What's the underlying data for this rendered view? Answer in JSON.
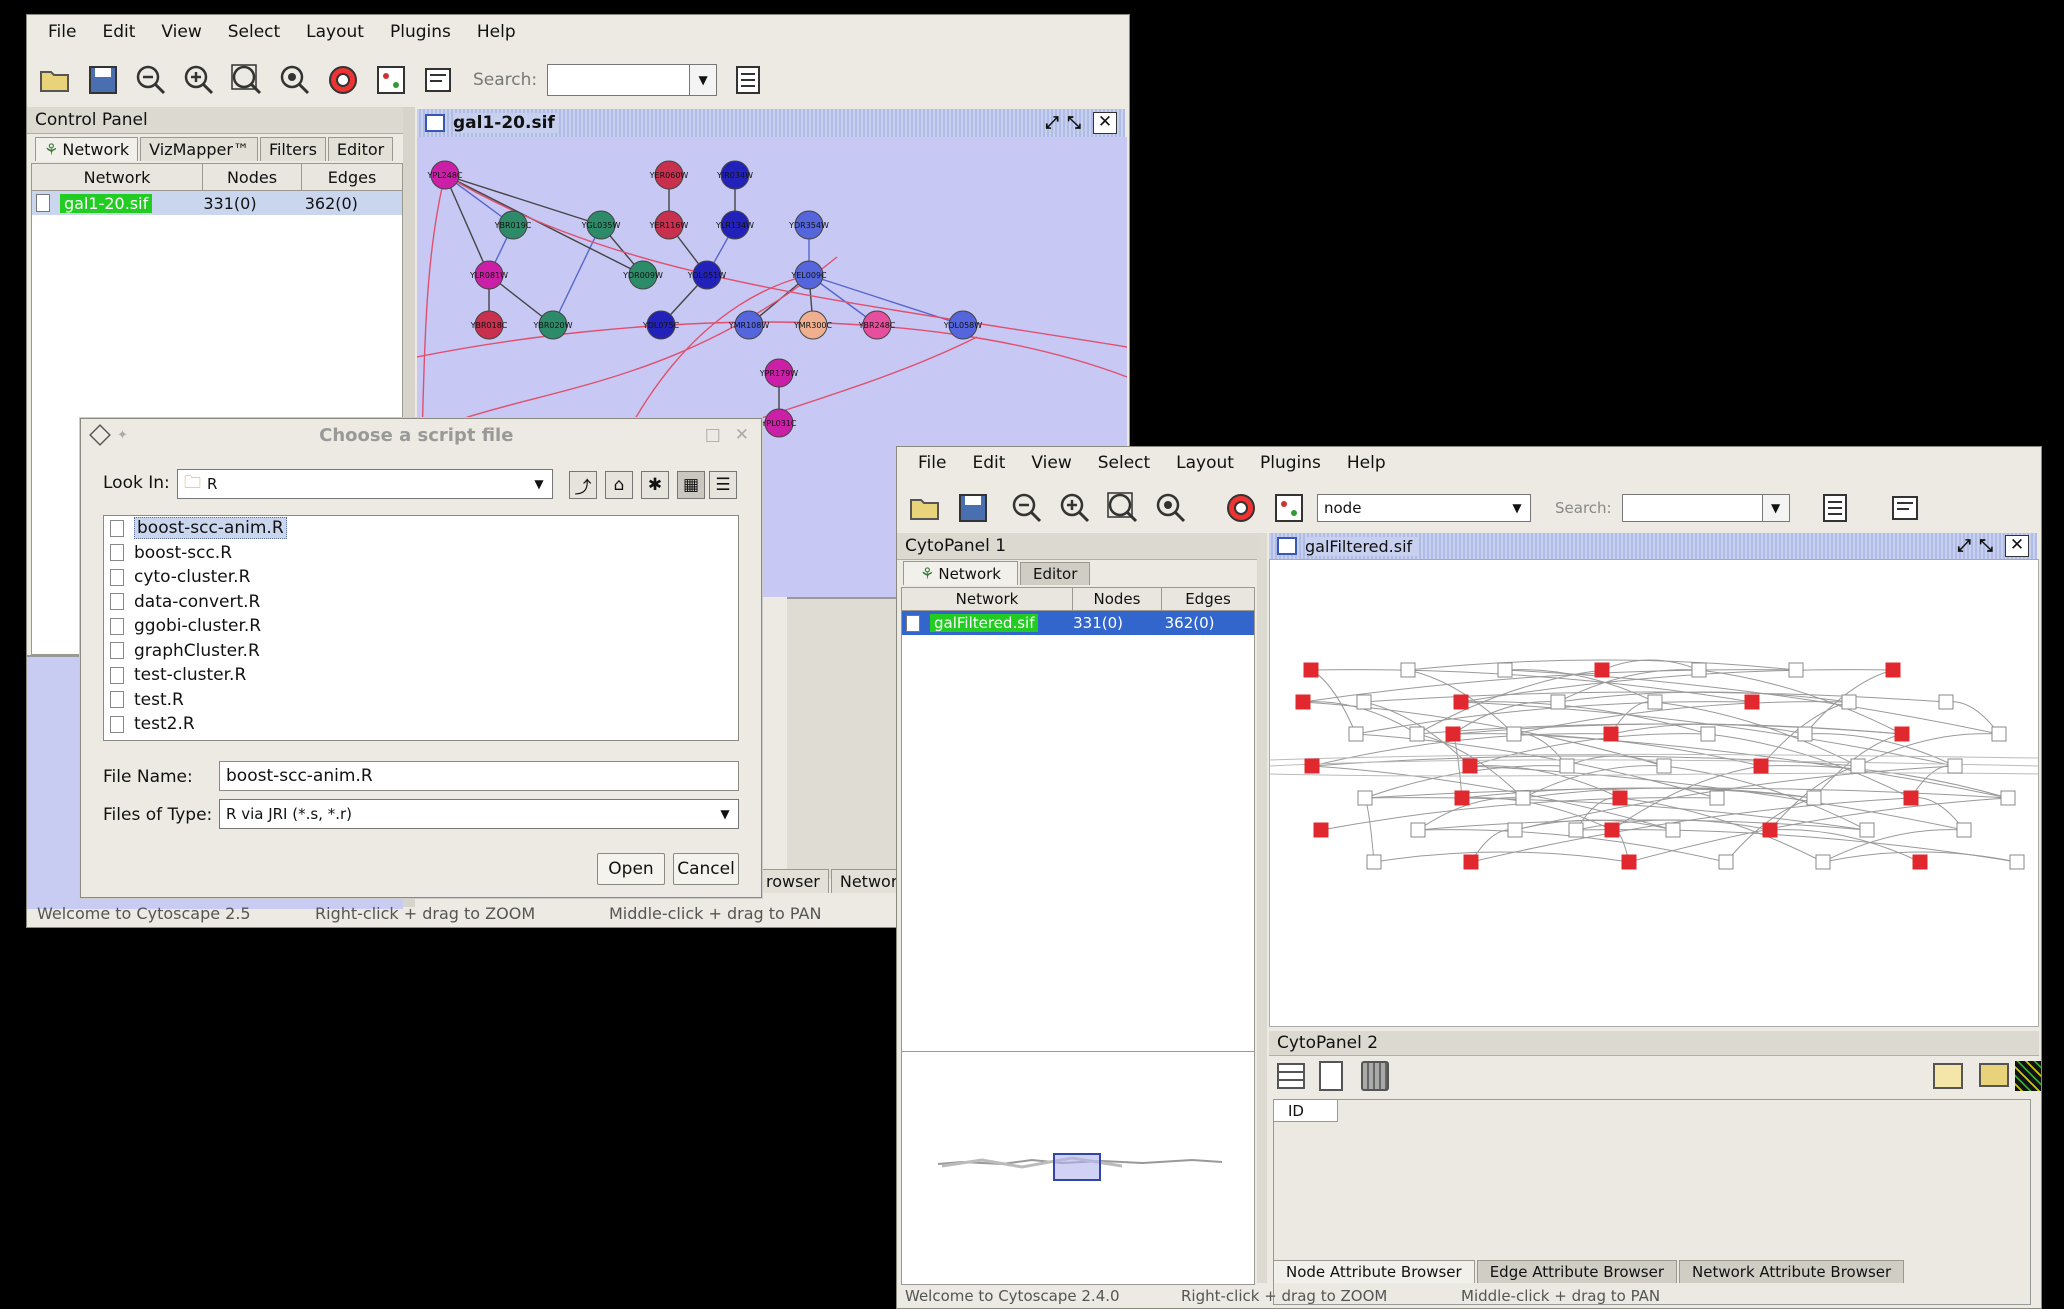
{
  "w1": {
    "menu": [
      "File",
      "Edit",
      "View",
      "Select",
      "Layout",
      "Plugins",
      "Help"
    ],
    "search_label": "Search:",
    "control_panel_title": "Control Panel",
    "tabs": [
      "Network",
      "VizMapper™",
      "Filters",
      "Editor"
    ],
    "table_headers": [
      "Network",
      "Nodes",
      "Edges"
    ],
    "row": {
      "name": "gal1-20.sif",
      "nodes": "331(0)",
      "edges": "362(0)"
    },
    "frame_title": "gal1-20.sif",
    "partial_tabs": [
      "rowser",
      "Network"
    ],
    "status": [
      "Welcome to Cytoscape 2.5",
      "Right-click + drag  to  ZOOM",
      "Middle-click + drag  to  PAN"
    ],
    "nodes": [
      {
        "label": "YPL248C",
        "color": "#cc1fa8"
      },
      {
        "label": "YBR019C",
        "color": "#2e8b6a"
      },
      {
        "label": "YGL035W",
        "color": "#2e8b6a"
      },
      {
        "label": "YLR081W",
        "color": "#cc1fa8"
      },
      {
        "label": "YER060W",
        "color": "#c8304e"
      },
      {
        "label": "YER116W",
        "color": "#c8304e"
      },
      {
        "label": "YIR034W",
        "color": "#2222bb"
      },
      {
        "label": "YLR134W",
        "color": "#2222bb"
      },
      {
        "label": "YDR009W",
        "color": "#2e8b6a"
      },
      {
        "label": "YOL051W",
        "color": "#2222bb"
      },
      {
        "label": "YDR354W",
        "color": "#5566dd"
      },
      {
        "label": "YEL009C",
        "color": "#5566dd"
      },
      {
        "label": "YBR018C",
        "color": "#c8304e"
      },
      {
        "label": "YBR020W",
        "color": "#2e8b6a"
      },
      {
        "label": "YDL075C",
        "color": "#2222bb"
      },
      {
        "label": "YMR108W",
        "color": "#5566dd"
      },
      {
        "label": "YMR300C",
        "color": "#f0b090"
      },
      {
        "label": "YBR248C",
        "color": "#e84e9e"
      },
      {
        "label": "YOL058W",
        "color": "#5566dd"
      },
      {
        "label": "YPR179W",
        "color": "#cc1fa8"
      },
      {
        "label": "YPL031C",
        "color": "#cc1fa8"
      }
    ]
  },
  "dialog": {
    "title": "Choose a script file",
    "look_in_label": "Look In:",
    "look_in_value": "R",
    "files": [
      "boost-scc-anim.R",
      "boost-scc.R",
      "cyto-cluster.R",
      "data-convert.R",
      "ggobi-cluster.R",
      "graphCluster.R",
      "test-cluster.R",
      "test.R",
      "test2.R"
    ],
    "selected_file": "boost-scc-anim.R",
    "file_name_label": "File Name:",
    "file_name_value": "boost-scc-anim.R",
    "files_of_type_label": "Files of Type:",
    "files_of_type_value": "R via JRI (*.s, *.r)",
    "open_label": "Open",
    "cancel_label": "Cancel"
  },
  "w2": {
    "menu": [
      "File",
      "Edit",
      "View",
      "Select",
      "Layout",
      "Plugins",
      "Help"
    ],
    "select_value": "node",
    "search_label": "Search:",
    "cytopanel1_title": "CytoPanel 1",
    "tabs": [
      "Network",
      "Editor"
    ],
    "table_headers": [
      "Network",
      "Nodes",
      "Edges"
    ],
    "row": {
      "name": "galFiltered.sif",
      "nodes": "331(0)",
      "edges": "362(0)"
    },
    "frame_title": "galFiltered.sif",
    "cytopanel2_title": "CytoPanel 2",
    "attr_column": "ID",
    "bottom_tabs": [
      "Node Attribute Browser",
      "Edge Attribute Browser",
      "Network Attribute Browser"
    ],
    "status": [
      "Welcome to Cytoscape 2.4.0",
      "Right-click + drag  to  ZOOM",
      "Middle-click + drag  to  PAN"
    ],
    "colors": {
      "selected_row": "#3366cc",
      "highlight": "#22cc22",
      "red_node": "#e0282e"
    }
  }
}
